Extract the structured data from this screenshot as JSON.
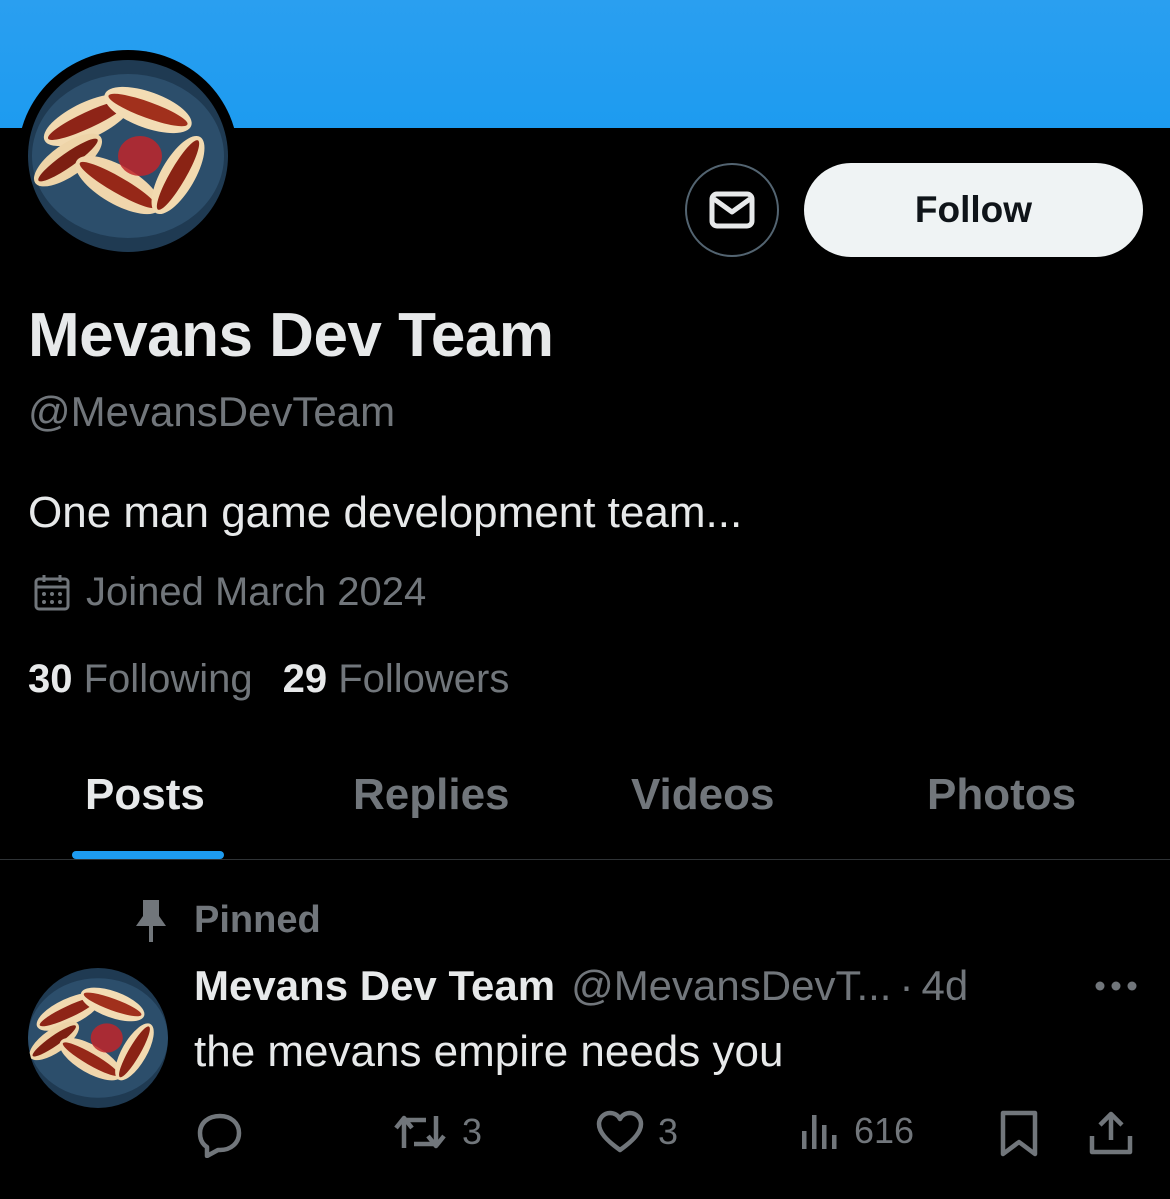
{
  "profile": {
    "display_name": "Mevans Dev Team",
    "handle": "@MevansDevTeam",
    "bio": "One man game development team...",
    "joined": "Joined March 2024",
    "following_count": "30",
    "following_label": "Following",
    "followers_count": "29",
    "followers_label": "Followers"
  },
  "actions": {
    "follow_label": "Follow",
    "message_icon": "envelope-icon"
  },
  "tabs": [
    {
      "label": "Posts",
      "active": true
    },
    {
      "label": "Replies",
      "active": false
    },
    {
      "label": "Videos",
      "active": false
    },
    {
      "label": "Photos",
      "active": false
    }
  ],
  "pinned_post": {
    "pinned_label": "Pinned",
    "author_name": "Mevans Dev Team",
    "author_handle": "@MevansDevT...",
    "separator": "·",
    "time": "4d",
    "text": "the mevans empire needs you",
    "reply_count": "",
    "repost_count": "3",
    "like_count": "3",
    "view_count": "616"
  },
  "colors": {
    "banner": "#1d9bf0",
    "accent": "#1d9bf0",
    "background": "#000000",
    "text_primary": "#e7e9ea",
    "text_secondary": "#71767b"
  }
}
